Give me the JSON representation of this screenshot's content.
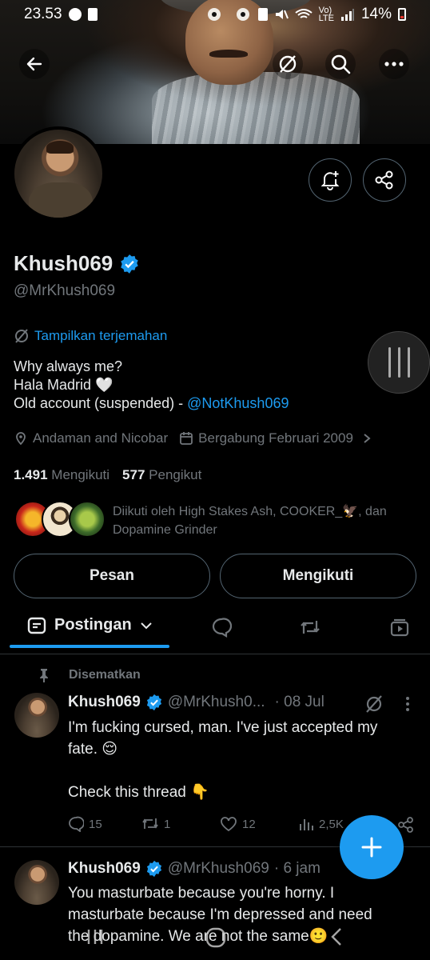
{
  "status_bar": {
    "time": "23.53",
    "signal_label": "Vo)\nLTE",
    "battery": "14%"
  },
  "profile": {
    "name": "Khush069",
    "handle": "@MrKhush069",
    "translate_label": "Tampilkan terjemahan",
    "bio_line1": "Why always me?",
    "bio_line2": "Hala Madrid 🤍",
    "bio_line3_prefix": "Old account (suspended) - ",
    "bio_line3_link": "@NotKhush069",
    "location": "Andaman and Nicobar",
    "joined": "Bergabung Februari 2009",
    "following_count": "1.491",
    "following_label": "Mengikuti",
    "followers_count": "577",
    "followers_label": "Pengikut",
    "followed_by_text": "Diikuti oleh High Stakes Ash, COOKER_🦅, dan Dopamine Grinder",
    "message_button": "Pesan",
    "following_button": "Mengikuti"
  },
  "tabs": {
    "active_label": "Postingan"
  },
  "pinned_label": "Disematkan",
  "tweets": [
    {
      "name": "Khush069",
      "handle": "@MrKhush0...",
      "time": "· 08 Jul",
      "text_line1": "I'm fucking cursed, man. I've just accepted my",
      "text_line2": "fate. 😌",
      "text_line3": "Check this thread 👇",
      "replies": "15",
      "reposts": "1",
      "likes": "12",
      "views": "2,5K"
    },
    {
      "name": "Khush069",
      "handle": "@MrKhush069",
      "time": "· 6 jam",
      "text_line1": "You masturbate because you're horny. I",
      "text_line2": "masturbate because I'm depressed and need",
      "text_line3": "the dopamine. We are not the same🙂"
    }
  ],
  "colors": {
    "accent": "#1d9bf0",
    "muted": "#71767b",
    "text": "#e7e9ea",
    "border": "#536471",
    "background": "#000000"
  },
  "icons": [
    "back-arrow-icon",
    "translate-icon",
    "search-icon",
    "more-icon",
    "notification-bell-icon",
    "share-icon",
    "verified-badge-icon",
    "location-icon",
    "calendar-icon",
    "chevron-right-icon",
    "chevron-down-icon",
    "reply-icon",
    "repost-icon",
    "like-icon",
    "views-icon",
    "compose-plus-icon",
    "pin-icon"
  ]
}
